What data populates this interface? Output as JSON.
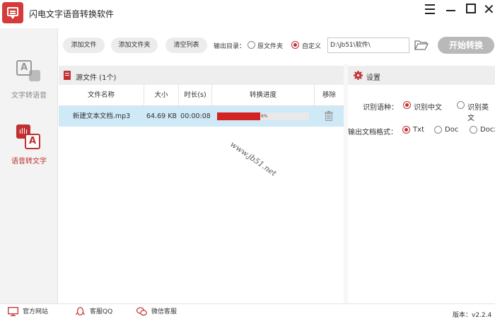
{
  "app": {
    "title": "闪电文字语音转换软件"
  },
  "sidebar": {
    "items": [
      {
        "label": "文字转语音"
      },
      {
        "label": "语音转文字"
      }
    ]
  },
  "toolbar": {
    "add_file": "添加文件",
    "add_folder": "添加文件夹",
    "clear_list": "清空列表",
    "output_label": "输出目录：",
    "option_original": "原文件夹",
    "option_custom": "自定义",
    "output_path": "D:\\jb51\\软件\\",
    "start": "开始转换"
  },
  "source": {
    "header": "源文件 (1个)",
    "columns": [
      "文件名称",
      "大小",
      "时长(s)",
      "转换进度",
      "移除"
    ],
    "rows": [
      {
        "name": "新建文本文档.mp3",
        "size": "64.69 KB",
        "duration": "00:00:08",
        "progress_text": "8%",
        "progress": 0.47
      }
    ]
  },
  "settings": {
    "header": "设置",
    "lang_label": "识别语种：",
    "lang_options": [
      "识别中文",
      "识别英文"
    ],
    "format_label": "输出文档格式：",
    "format_options": [
      "Txt",
      "Doc",
      "Docx"
    ]
  },
  "watermark": "www.jb51.net",
  "footer": {
    "website": "官方网站",
    "qq": "客服QQ",
    "wechat": "微信客服",
    "version": "版本：v2.2.4"
  },
  "colors": {
    "accent": "#c03030",
    "progress": "#d52222",
    "selected_row": "#cfe9f7"
  }
}
